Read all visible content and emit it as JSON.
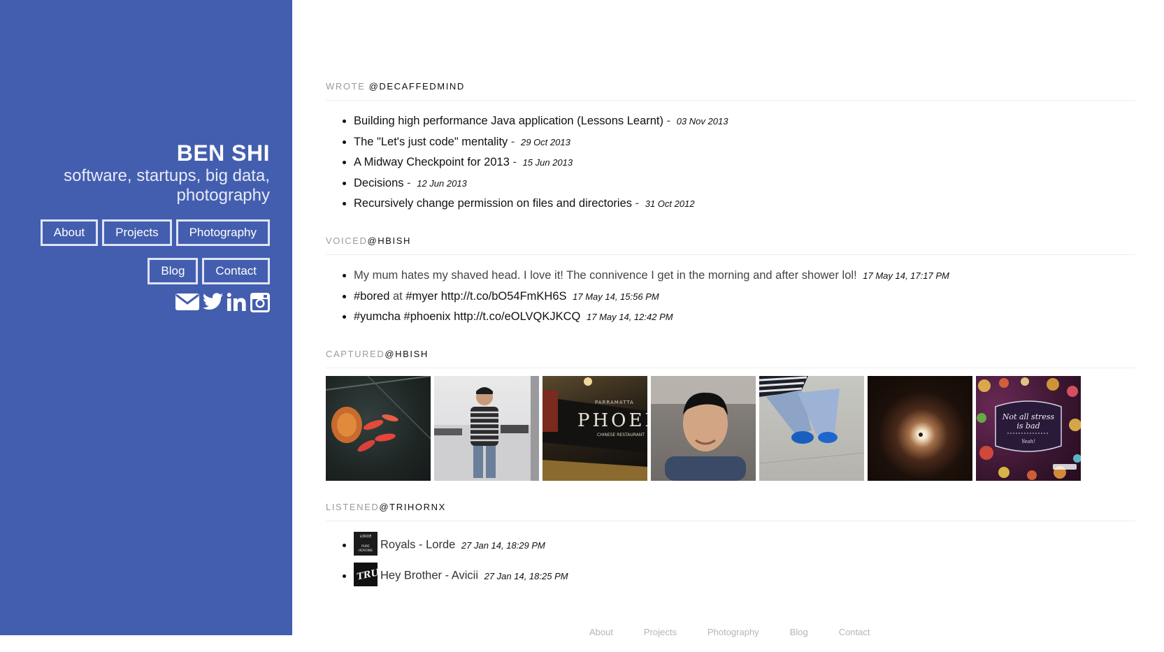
{
  "profile": {
    "name": "BEN SHI",
    "tagline_line1": "software, startups, big data,",
    "tagline_line2": "photography"
  },
  "nav": {
    "row1": [
      "About",
      "Projects",
      "Photography"
    ],
    "row2": [
      "Blog",
      "Contact"
    ]
  },
  "social_icons": [
    "email-icon",
    "twitter-icon",
    "linkedin-icon",
    "instagram-icon"
  ],
  "sections": {
    "wrote": {
      "verb": "WROTE",
      "handle": "@DECAFFEDMIND",
      "items": [
        {
          "title": "Building high performance Java application (Lessons Learnt)",
          "date": "03 Nov 2013"
        },
        {
          "title": "The \"Let's just code\" mentality",
          "date": "29 Oct 2013"
        },
        {
          "title": "A Midway Checkpoint for 2013",
          "date": "15 Jun 2013"
        },
        {
          "title": "Decisions",
          "date": "12 Jun 2013"
        },
        {
          "title": "Recursively change permission on files and directories",
          "date": "31 Oct 2012"
        }
      ]
    },
    "voiced": {
      "verb": "VOICED",
      "handle": "@HBISH",
      "tweet1": {
        "text": "My mum hates my shaved head. I love it! The connivence I get in the morning and after shower lol!",
        "date": "17 May 14, 17:17 PM"
      },
      "tweet2": {
        "tag1": "#bored",
        "mid": "at",
        "tag2": "#myer",
        "link": "http://t.co/bO54FmKH6S",
        "date": "17 May 14, 15:56 PM"
      },
      "tweet3": {
        "tag1": "#yumcha",
        "tag2": "#phoenix",
        "link": "http://t.co/eOLVQKJKCQ",
        "date": "17 May 14, 12:42 PM"
      }
    },
    "captured": {
      "verb": "CAPTURED",
      "handle": "@HBISH",
      "photos": [
        "goldfish pond",
        "mirror selfie in striped sweater",
        "Parramatta Phoenix Chinese Restaurant sign",
        "selfie portrait",
        "jeans and blue shoes",
        "glowing light",
        "Not all stress is bad quote"
      ],
      "photo3_text": "PHOENI",
      "photo3_sub": "PARRAMATTA",
      "photo3_sub2": "CHINESE RESTAURANT",
      "photo7_line1": "Not all stress",
      "photo7_line2": "is bad",
      "photo7_line3": "Yeah!"
    },
    "listened": {
      "verb": "LISTENED",
      "handle": "@TRIHORNX",
      "tracks": [
        {
          "title": "Royals - Lorde",
          "date": "27 Jan 14, 18:29 PM",
          "art1": "LORDE",
          "art2": "PURE",
          "art3": "HEROINE"
        },
        {
          "title": "Hey Brother - Avicii",
          "date": "27 Jan 14, 18:25 PM",
          "art1": "TRUE"
        }
      ]
    }
  },
  "footer": [
    "About",
    "Projects",
    "Photography",
    "Blog",
    "Contact"
  ],
  "colors": {
    "sidebar": "#435eaf",
    "nav_border": "#dfe4f4",
    "muted_heading": "#9b9b9b",
    "footer_link": "#b5b5b5"
  }
}
